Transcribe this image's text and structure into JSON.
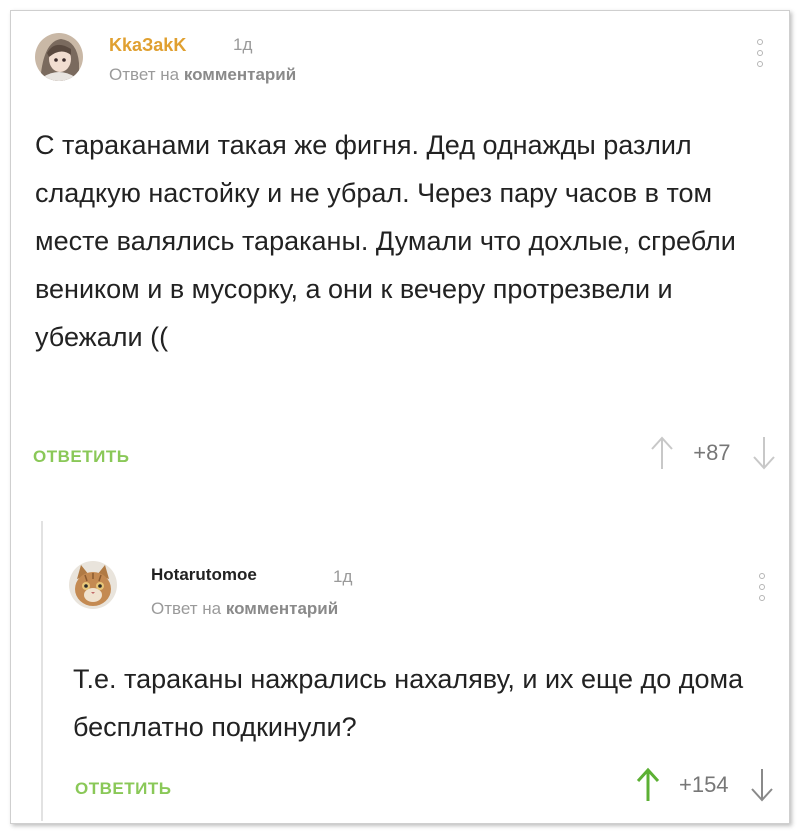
{
  "comments": [
    {
      "author": "KkaЗakK",
      "time": "1д",
      "reply_prefix": "Ответ на",
      "reply_target": "комментарий",
      "text": "С тараканами такая же фигня. Дед однажды разлил сладкую настойку и не убрал. Через пару часов в том месте валялись тараканы. Думали что дохлые, сгребли веником и в мусорку, а они к вечеру протрезвели и убежали ((",
      "reply_label": "ОТВЕТИТЬ",
      "score": "+87",
      "upvoted": false,
      "author_color": "#e0a031"
    },
    {
      "author": "Hotarutomoe",
      "time": "1д",
      "reply_prefix": "Ответ на",
      "reply_target": "комментарий",
      "text": "Т.е. тараканы нажрались нахаляву, и их еще до дома бесплатно подкинули?",
      "reply_label": "ОТВЕТИТЬ",
      "score": "+154",
      "upvoted": true,
      "author_color": "#222222"
    }
  ],
  "colors": {
    "accent_green": "#8ac858",
    "upvote_active": "#5cb034",
    "muted": "#9a9a9a"
  }
}
